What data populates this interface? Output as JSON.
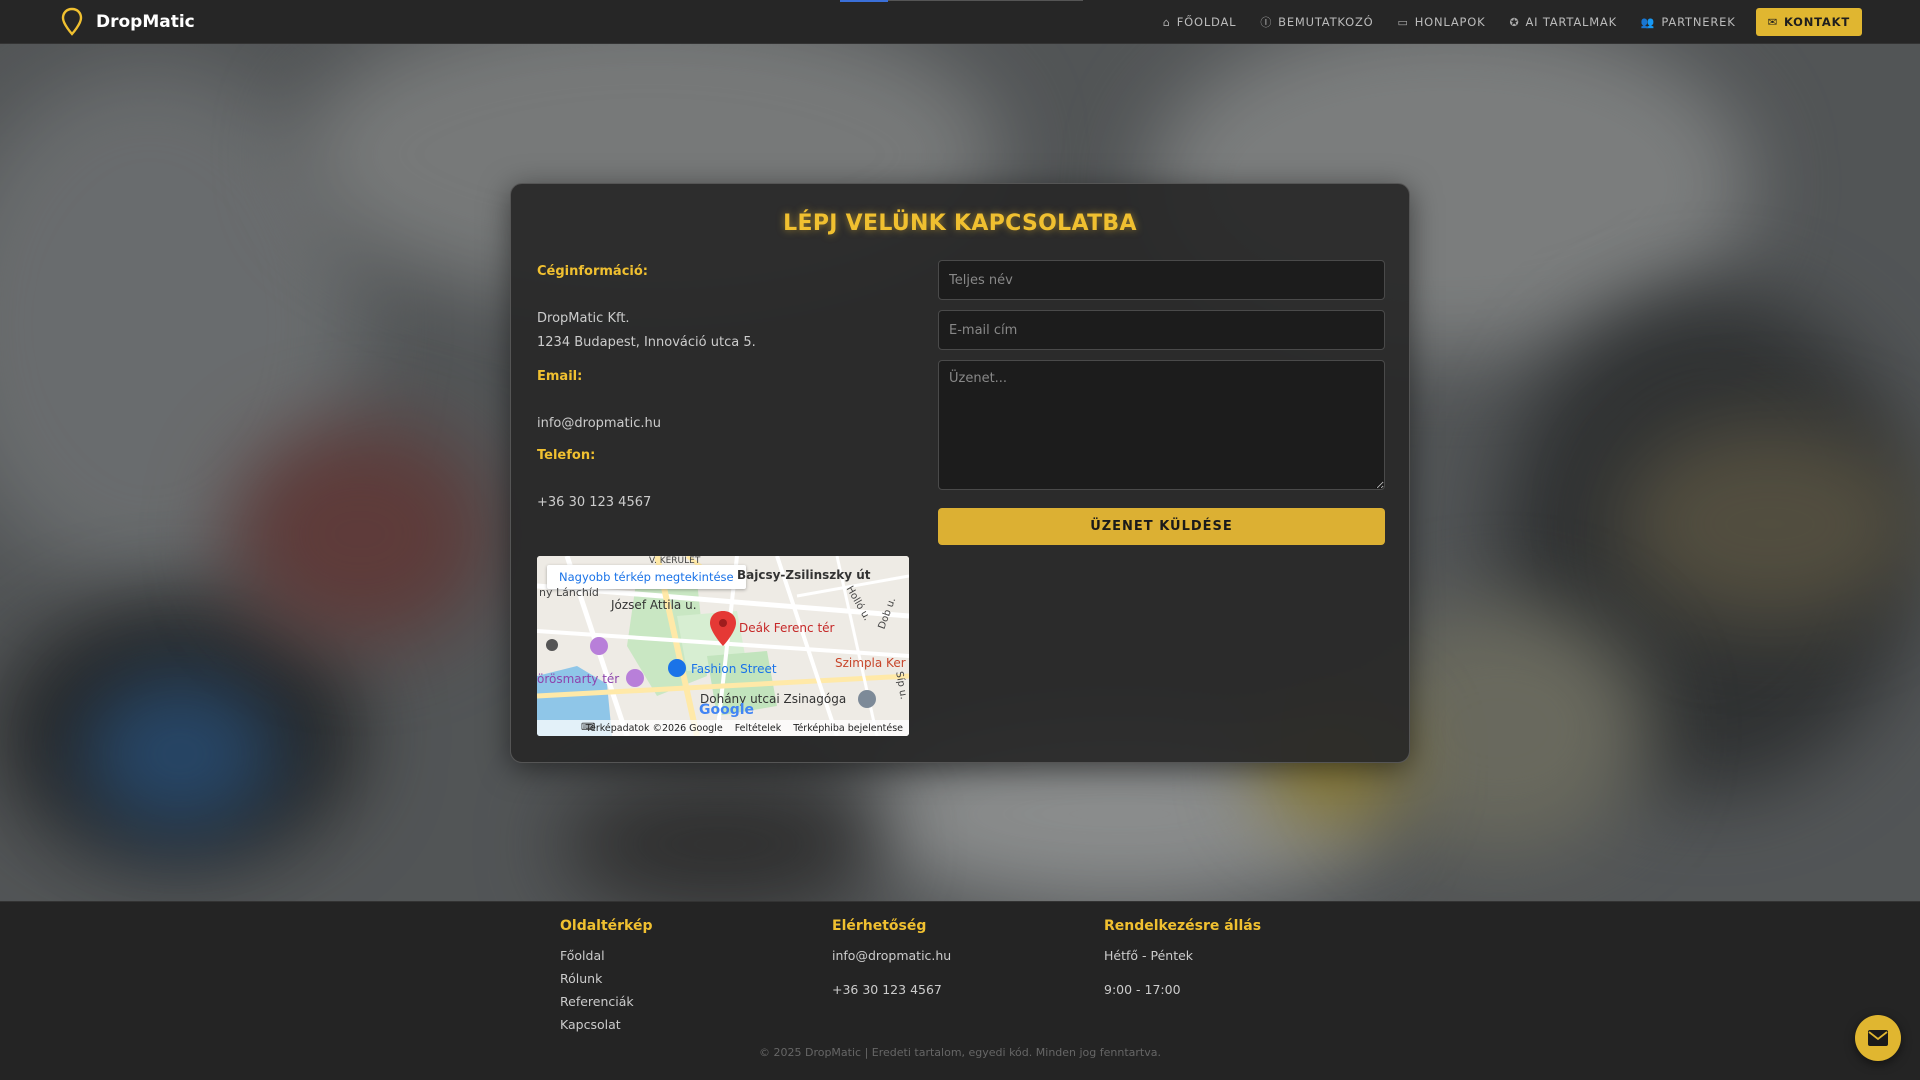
{
  "nav": {
    "brand": "DropMatic",
    "links": [
      {
        "icon": "⌂",
        "label": "FŐOLDAL"
      },
      {
        "icon": "ⓘ",
        "label": "BEMUTATKOZÓ"
      },
      {
        "icon": "▭",
        "label": "HONLAPOK"
      },
      {
        "icon": "✪",
        "label": "AI TARTALMAK"
      },
      {
        "icon": "👥",
        "label": "PARTNEREK"
      }
    ],
    "cta": {
      "icon": "✉",
      "label": "KONTAKT"
    }
  },
  "contact": {
    "title": "LÉPJ VELÜNK KAPCSOLATBA",
    "company_label": "Céginformáció:",
    "company_name": "DropMatic Kft.",
    "company_address": "1234 Budapest, Innováció utca 5.",
    "email_label": "Email:",
    "email": "info@dropmatic.hu",
    "phone_label": "Telefon:",
    "phone": "+36 30 123 4567",
    "map": {
      "link": "Nagyobb térkép megtekintése",
      "labels": {
        "district": "V. KERÜLET",
        "metro": "Bajcsy-Zsilinszky út",
        "street1": "József Attila u.",
        "pin": "Deák Ferenc tér",
        "fashion": "Fashion Street",
        "szimpla": "Szimpla Ker",
        "vorosmarty": "örösmarty tér",
        "synagogue": "Dohány utcai Zsinagóga",
        "lanchid": "ny Lánchíd",
        "hollo": "Holló u.",
        "dob": "Dob u.",
        "sip": "Síp u."
      },
      "logo": "Google",
      "footer": {
        "data": "Térképadatok ©2026 Google",
        "terms": "Feltételek",
        "report": "Térképhiba bejelentése"
      }
    },
    "form": {
      "name_placeholder": "Teljes név",
      "email_placeholder": "E-mail cím",
      "message_placeholder": "Üzenet...",
      "submit_label": "ÜZENET KÜLDÉSE"
    }
  },
  "footer": {
    "sitemap": {
      "heading": "Oldaltérkép",
      "links": [
        "Főoldal",
        "Rólunk",
        "Referenciák",
        "Kapcsolat"
      ]
    },
    "availability": {
      "heading": "Elérhetőség",
      "email": "info@dropmatic.hu",
      "phone": "+36 30 123 4567"
    },
    "hours": {
      "heading": "Rendelkezésre állás",
      "days": "Hétfő - Péntek",
      "time": "9:00 - 17:00"
    },
    "copyright": "© 2025 DropMatic | Eredeti tartalom, egyedi kód. Minden jog fenntartva."
  },
  "colors": {
    "accent": "#f0c030",
    "button": "#dcb033",
    "card_bg": "#282828"
  }
}
